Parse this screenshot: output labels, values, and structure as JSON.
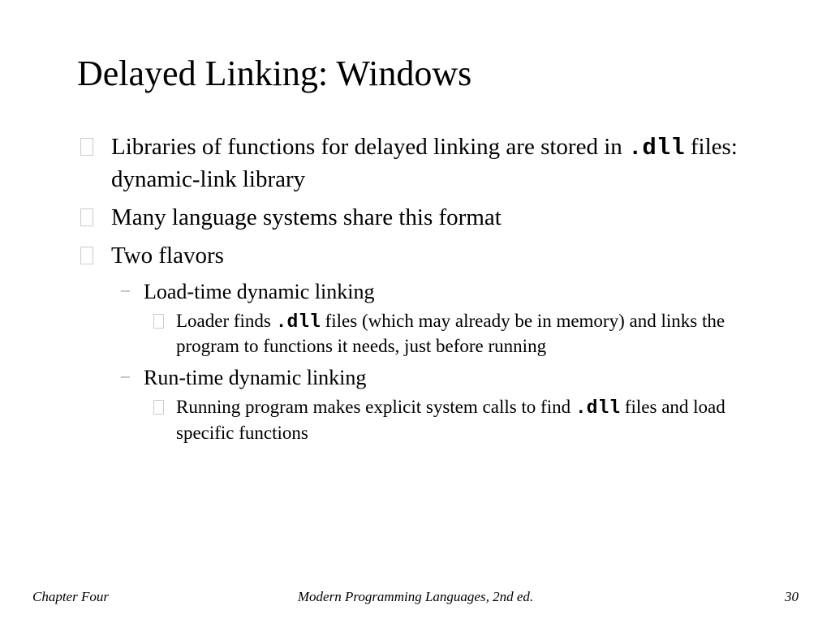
{
  "title": "Delayed Linking: Windows",
  "b1_a": "Libraries of functions for delayed linking are stored in ",
  "b1_code": ".dll",
  "b1_b": " files: dynamic-link library",
  "b2": "Many language systems share this format",
  "b3": "Two flavors",
  "b3_1": "Load-time dynamic linking",
  "b3_1_1a": "Loader finds ",
  "b3_1_1code": ".dll",
  "b3_1_1b": " files (which may already be in memory) and links the program to functions it needs, just before running",
  "b3_2": "Run-time dynamic linking",
  "b3_2_1a": "Running program makes explicit system calls to find ",
  "b3_2_1code": ".dll",
  "b3_2_1b": " files and load specific functions",
  "footer_left": "Chapter Four",
  "footer_center": "Modern Programming Languages, 2nd ed.",
  "footer_right": "30"
}
